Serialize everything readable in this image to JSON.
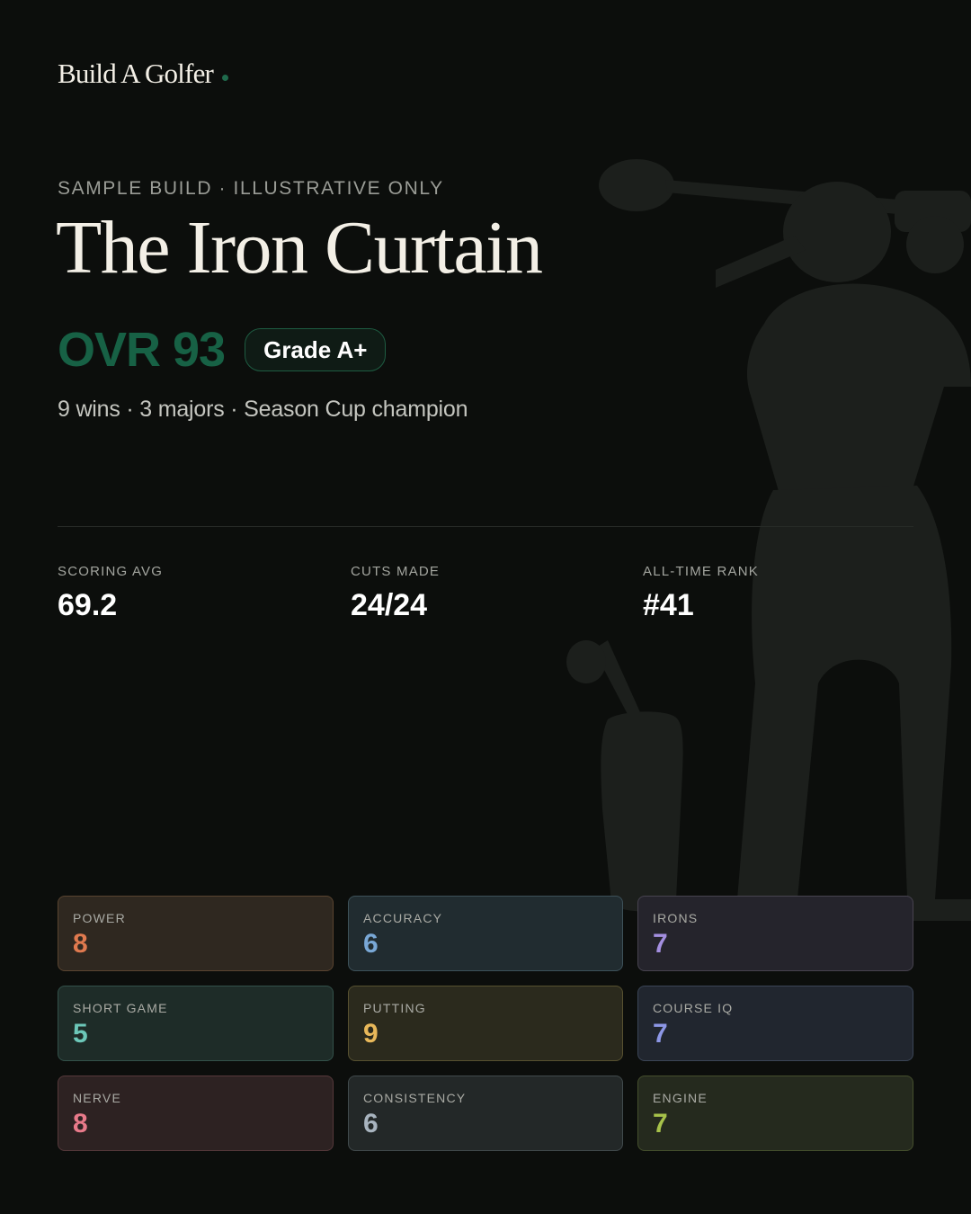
{
  "brand": {
    "name": "Build A Golfer",
    "dot_color": "#1f6a4c"
  },
  "hero": {
    "eyebrow": "SAMPLE BUILD · ILLUSTRATIVE ONLY",
    "title": "The Iron Curtain",
    "ovr": "OVR 93",
    "ovr_color": "#176145",
    "grade": "Grade A+",
    "grade_border": "#1e5c42",
    "subline": "9 wins · 3 majors · Season Cup champion"
  },
  "stats": [
    {
      "label": "SCORING AVG",
      "value": "69.2"
    },
    {
      "label": "CUTS MADE",
      "value": "24/24"
    },
    {
      "label": "ALL-TIME RANK",
      "value": "#41"
    }
  ],
  "attributes": [
    {
      "label": "POWER",
      "value": "8",
      "color": "#e07a4f",
      "bg": "#2f2820",
      "border": "#5a4430"
    },
    {
      "label": "ACCURACY",
      "value": "6",
      "color": "#79a8d6",
      "bg": "#212c30",
      "border": "#3d5159"
    },
    {
      "label": "IRONS",
      "value": "7",
      "color": "#a48fe0",
      "bg": "#25242c",
      "border": "#47434f"
    },
    {
      "label": "SHORT GAME",
      "value": "5",
      "color": "#6cc7b8",
      "bg": "#1e2c28",
      "border": "#33514a"
    },
    {
      "label": "PUTTING",
      "value": "9",
      "color": "#e8b85a",
      "bg": "#2b2a1d",
      "border": "#575130"
    },
    {
      "label": "COURSE IQ",
      "value": "7",
      "color": "#8d97e6",
      "bg": "#21262f",
      "border": "#3b4556"
    },
    {
      "label": "NERVE",
      "value": "8",
      "color": "#e87a8a",
      "bg": "#2d2222",
      "border": "#56393b"
    },
    {
      "label": "CONSISTENCY",
      "value": "6",
      "color": "#a8b4bf",
      "bg": "#232828",
      "border": "#414a4c"
    },
    {
      "label": "ENGINE",
      "value": "7",
      "color": "#a7c24a",
      "bg": "#252a1e",
      "border": "#454f2d"
    }
  ],
  "icons": {
    "silhouette": "golfer-silhouette-icon",
    "logo_dot": "logo-dot-icon"
  }
}
